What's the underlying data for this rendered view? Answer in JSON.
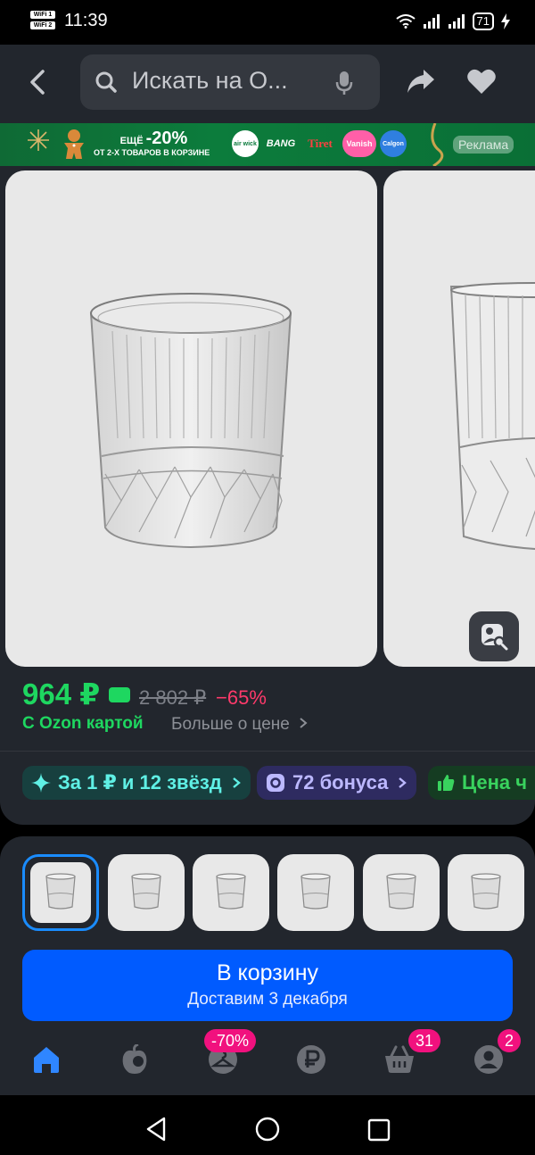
{
  "status_bar": {
    "time": "11:39",
    "wifi_badge_1": "WiFi 1",
    "wifi_badge_2": "WiFi 2",
    "battery": "71"
  },
  "header": {
    "search_placeholder": "Искать на О..."
  },
  "banner": {
    "line1_prefix": "ЕЩЁ",
    "line1_percent": "-20%",
    "line2": "ОТ 2-Х ТОВАРОВ В КОРЗИНЕ",
    "brands": [
      "air wick",
      "BANG",
      "Tiret",
      "Vanish",
      "Calgon"
    ],
    "ad_label": "Реклама"
  },
  "product": {
    "price": "964 ₽",
    "old_price": "2 802 ₽",
    "discount": "−65%",
    "ozon_card_label": "С Ozon картой",
    "more_price_label": "Больше о цене",
    "chips": [
      {
        "label": "За 1 ₽ и 12 звёзд"
      },
      {
        "label": "72 бонуса"
      },
      {
        "label": "Цена ч"
      }
    ]
  },
  "thumbnails_count_visible": 6,
  "cart_button": {
    "title": "В корзину",
    "subtitle": "Доставим 3 декабря"
  },
  "tabbar": {
    "badges": {
      "sale": "-70%",
      "cart": "31",
      "profile": "2"
    }
  },
  "colors": {
    "accent_blue": "#005bff",
    "price_green": "#1ed760",
    "discount_pink": "#ff3a6b",
    "badge_pink": "#f1117e",
    "surface": "#22262d"
  }
}
